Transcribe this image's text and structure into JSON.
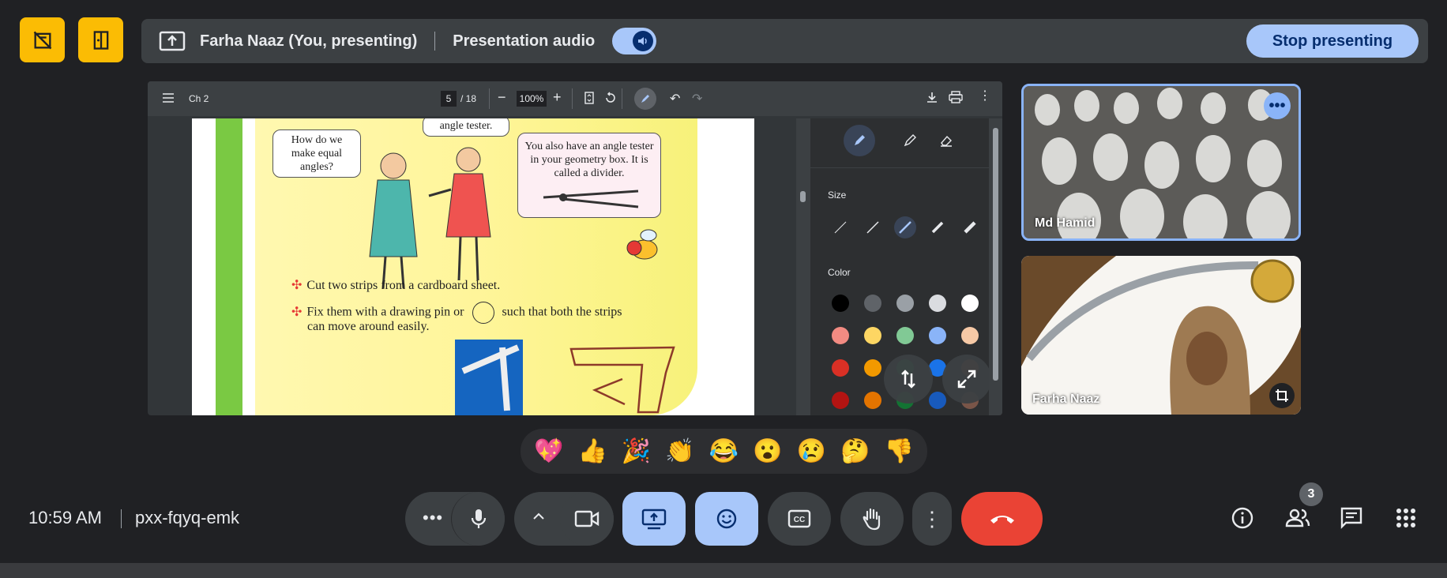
{
  "top_bar": {
    "presenter_label": "Farha Naaz (You, presenting)",
    "presentation_audio_label": "Presentation audio",
    "stop_presenting_label": "Stop presenting",
    "icons": [
      "camera-off-icon",
      "exit-icon",
      "present-icon",
      "volume-icon"
    ]
  },
  "pdf_viewer": {
    "title": "Ch 2",
    "page_current": "5",
    "page_total": "/ 18",
    "zoom": "100%",
    "page_content": {
      "bubble_1": "How do we make equal angles?",
      "bubble_2": "angle tester.",
      "bubble_3": "You also have an angle tester in your geometry box. It is called a divider.",
      "bullet_1": "Cut two strips from a cardboard sheet.",
      "bullet_2_a": "Fix them with a drawing pin or",
      "bullet_2_b": "such that both the strips",
      "bullet_2_c": "can move around easily."
    },
    "annotation_panel": {
      "size_label": "Size",
      "color_label": "Color",
      "colors": [
        "#000000",
        "#5f6368",
        "#9aa0a6",
        "#dadce0",
        "#ffffff",
        "#f28b82",
        "#fdd663",
        "#81c995",
        "#8ab4f8",
        "#f6c9a6",
        "#d93025",
        "#f29900",
        "#1e8e3e",
        "#1a73e8",
        "#a0522d",
        "#b31412",
        "#e37400",
        "#137333",
        "#185abc",
        "#795548"
      ]
    }
  },
  "tiles": {
    "tile_1_name": "Md Hamid",
    "tile_2_name": "Farha Naaz"
  },
  "reactions": [
    "💖",
    "👍",
    "🎉",
    "👏",
    "😂",
    "😮",
    "😢",
    "🤔",
    "👎"
  ],
  "bottom_bar": {
    "time": "10:59 AM",
    "meeting_code": "pxx-fqyq-emk",
    "participants_count": "3"
  }
}
